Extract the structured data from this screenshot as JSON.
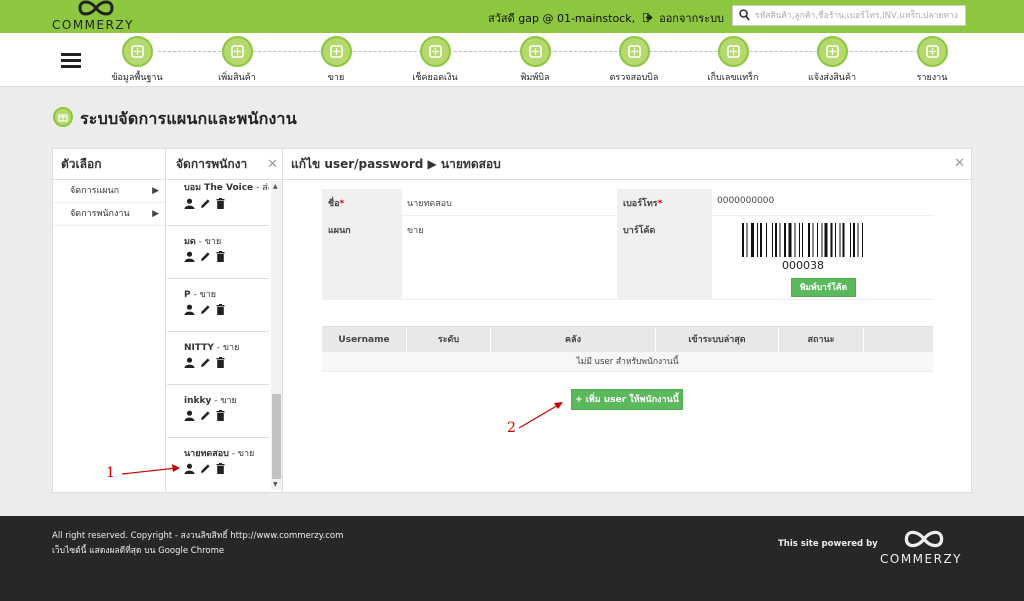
{
  "brand": {
    "name": "COMMERZY"
  },
  "topbar": {
    "greeting": "สวัสดี gap @ 01-mainstock,",
    "logout": "ออกจากระบบ",
    "search_placeholder": "รหัสสินค้า,ลูกค้า,ชื่อร้าน,เบอร์โทร,INV,แทร็ก,ปลายทาง"
  },
  "nav": [
    {
      "label": "ข้อมูลพื้นฐาน",
      "icon": "database-icon"
    },
    {
      "label": "เพิ่มสินค้า",
      "icon": "box-icon"
    },
    {
      "label": "ขาย",
      "icon": "cash-register-icon"
    },
    {
      "label": "เช็คยอดเงิน",
      "icon": "check-money-icon"
    },
    {
      "label": "พิมพ์บิล",
      "icon": "printer-icon"
    },
    {
      "label": "ตรวจสอบบิล",
      "icon": "bill-check-icon"
    },
    {
      "label": "เก็บเลขแทร็ก",
      "icon": "tracking-icon"
    },
    {
      "label": "แจ้งส่งสินค้า",
      "icon": "truck-icon"
    },
    {
      "label": "รายงาน",
      "icon": "report-icon"
    }
  ],
  "page": {
    "title": "ระบบจัดการแผนกและพนักงาน"
  },
  "options": {
    "title": "ตัวเลือก",
    "items": [
      {
        "label": "จัดการแผนก",
        "arrow": "▶"
      },
      {
        "label": "จัดการพนักงาน",
        "arrow": "▶"
      }
    ]
  },
  "employees": {
    "title": "จัดการพนักงา",
    "close": "✕",
    "list": [
      {
        "name": "บอม The Voice",
        "dept": " - ส่ง"
      },
      {
        "name": "มด",
        "dept": " - ขาย"
      },
      {
        "name": "P",
        "dept": " - ขาย"
      },
      {
        "name": "NITTY",
        "dept": " - ขาย"
      },
      {
        "name": "inkky",
        "dept": " - ขาย"
      },
      {
        "name": "นายทดสอบ",
        "dept": " - ขาย"
      }
    ]
  },
  "editor": {
    "title": "แก้ไข user/password ▶ นายทดสอบ",
    "close": "✕",
    "name_label": "ชื่อ",
    "name_value": "นายทดสอบ",
    "phone_label": "เบอร์โทร",
    "phone_value": "0000000000",
    "dept_label": "แผนก",
    "dept_value": "ขาย",
    "barcode_label": "บาร์โค้ด",
    "barcode_number": "000038",
    "print_barcode": "พิมพ์บาร์โค้ด",
    "required_mark": "*"
  },
  "users_table": {
    "headers": [
      "Username",
      "ระดับ",
      "คลัง",
      "เข้าระบบล่าสุด",
      "สถานะ",
      ""
    ],
    "empty_text": "ไม่มี user สำหรับพนักงานนี้"
  },
  "add_user_button": "+ เพิ่ม user ให้พนักงานนี้",
  "annotations": {
    "one": "1",
    "two": "2",
    "color": "#cc0000"
  },
  "footer": {
    "copyright": "All right reserved. Copyright - สงวนลิขสิทธิ์ http://www.commerzy.com",
    "browser_note": "เว็บไซต์นี้ แสดงผลดีที่สุด บน Google Chrome",
    "powered_by": "This site powered by"
  },
  "colors": {
    "accent": "#8dc63f",
    "button": "#5cb85c",
    "footer": "#272727"
  }
}
